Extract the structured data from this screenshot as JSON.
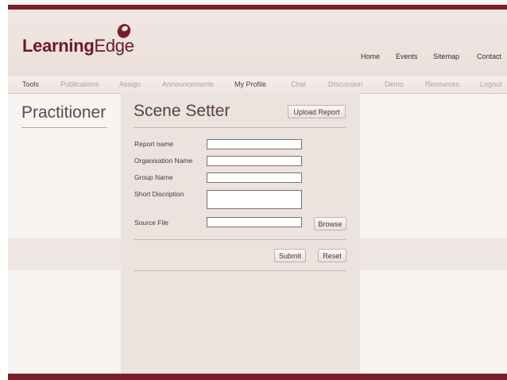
{
  "brand": {
    "name_bold": "Learning",
    "name_rest": "Edge"
  },
  "top_links": [
    "Home",
    "Events",
    "Sitemap",
    "Contact"
  ],
  "nav": {
    "items": [
      "Tools",
      "Publications",
      "Assign",
      "Announcements",
      "My Profile",
      "Chat",
      "Discussion",
      "Demo",
      "Resources",
      "Logout"
    ],
    "active": "Tools"
  },
  "sidebar": {
    "title": "Practitioner"
  },
  "form": {
    "title": "Scene Setter",
    "upload_label": "Upload Report",
    "fields": [
      {
        "label": "Report name",
        "value": ""
      },
      {
        "label": "Organisation Name",
        "value": ""
      },
      {
        "label": "Group Name",
        "value": ""
      },
      {
        "label": "Short Discription",
        "value": ""
      },
      {
        "label": "Source File",
        "value": ""
      }
    ],
    "browse_label": "Browse",
    "submit_label": "Submit",
    "reset_label": "Reset"
  },
  "colors": {
    "brand": "#7a1f26",
    "header_bg": "#f1e6e3",
    "panel_bg": "#ece3df"
  }
}
